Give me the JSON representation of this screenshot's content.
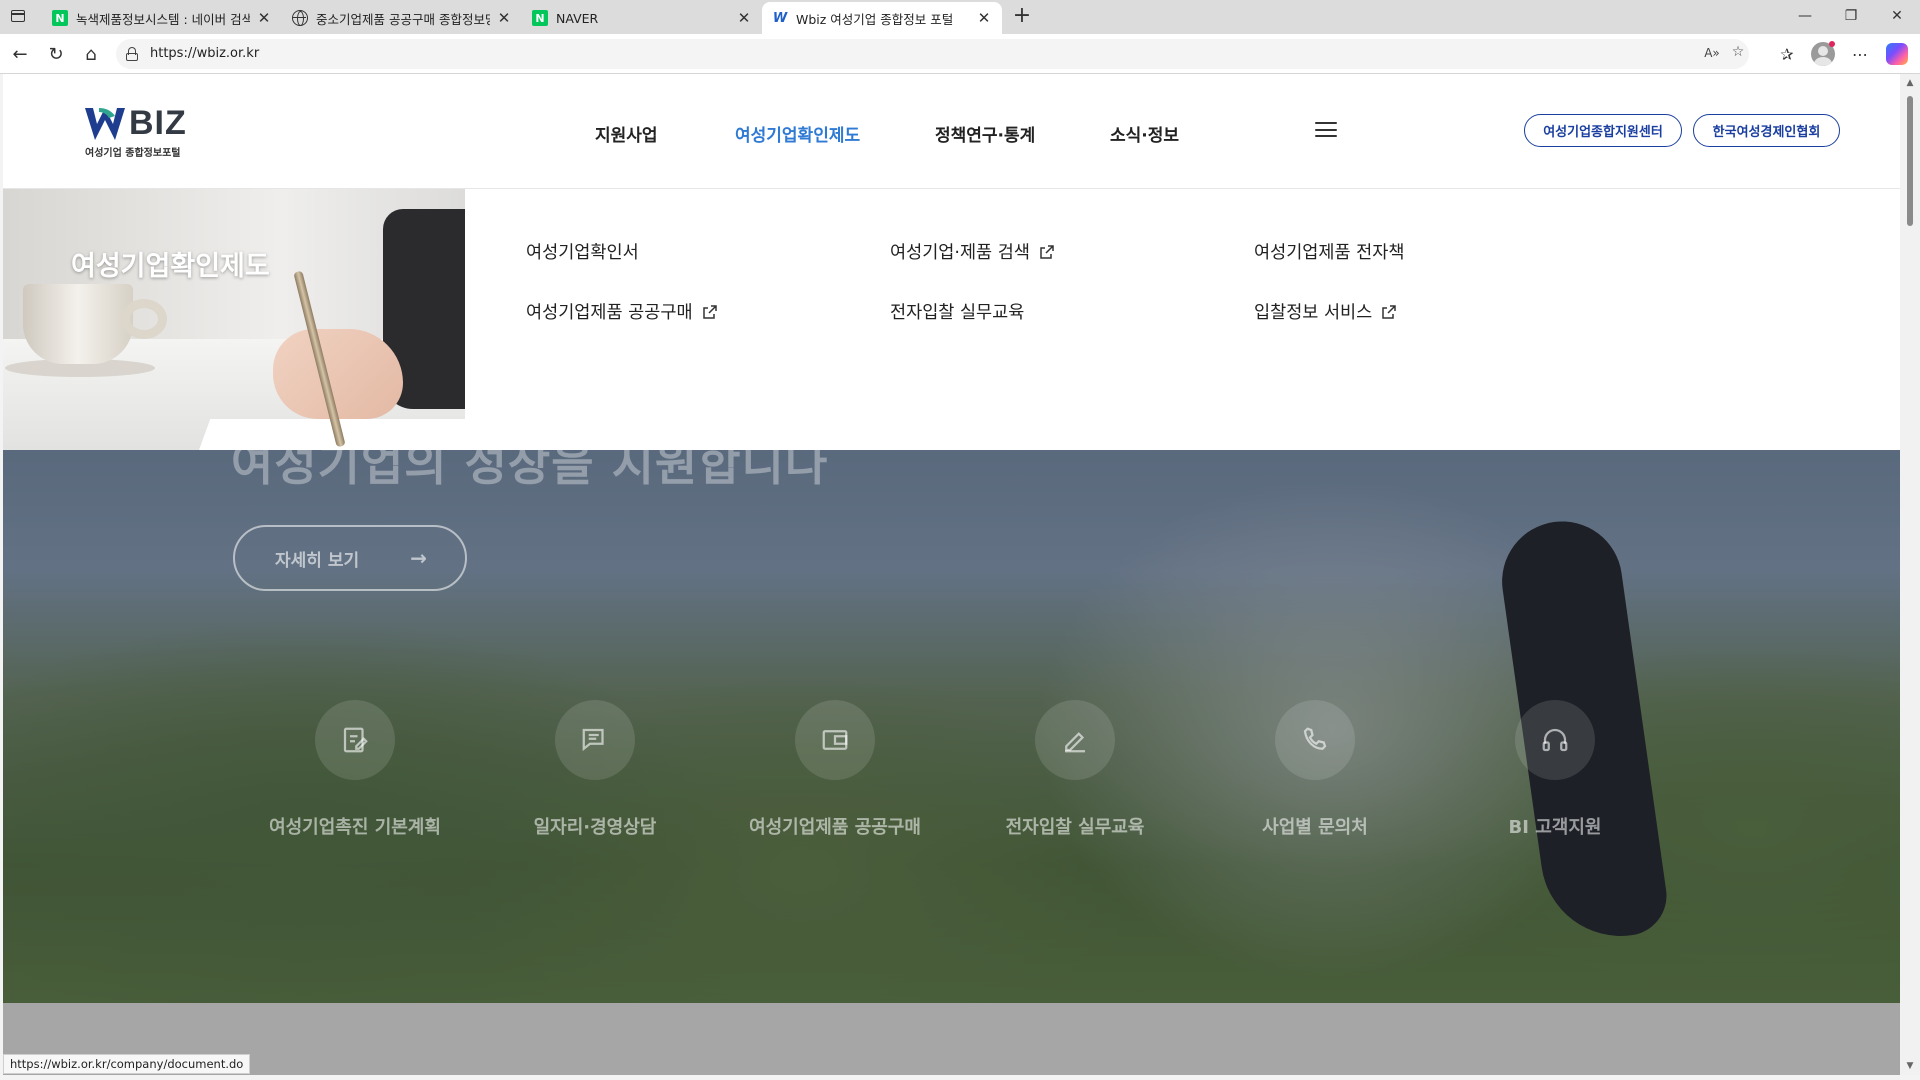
{
  "browser": {
    "tabs": [
      {
        "title": "녹색제품정보시스템 : 네이버 검색",
        "favicon": "naver-icon"
      },
      {
        "title": "중소기업제품 공공구매 종합정보망",
        "favicon": "globe-icon"
      },
      {
        "title": "NAVER",
        "favicon": "naver-icon"
      },
      {
        "title": "Wbiz 여성기업 종합정보 포털",
        "favicon": "wbiz-icon",
        "active": true
      }
    ],
    "url": "https://wbiz.or.kr",
    "status_url": "https://wbiz.or.kr/company/document.do"
  },
  "header": {
    "logo_text": "BIZ",
    "logo_sub": "여성기업 종합정보포털",
    "nav": [
      "지원사업",
      "여성기업확인제도",
      "정책연구·통계",
      "소식·정보"
    ],
    "active_nav_index": 1,
    "pill_buttons": [
      "여성기업종합지원센터",
      "한국여성경제인협회"
    ],
    "accent_color": "#2f7ad4",
    "pill_color": "#1b3fa0"
  },
  "mega_menu": {
    "title": "여성기업확인제도",
    "links": [
      {
        "label": "여성기업확인서",
        "external": false
      },
      {
        "label": "여성기업·제품 검색",
        "external": true
      },
      {
        "label": "여성기업제품 전자책",
        "external": false
      },
      {
        "label": "여성기업제품 공공구매",
        "external": true
      },
      {
        "label": "전자입찰 실무교육",
        "external": false
      },
      {
        "label": "입찰정보 서비스",
        "external": true
      }
    ]
  },
  "hero": {
    "heading": "여성기업의 성장을 지원합니다",
    "detail_button": "자세히 보기",
    "quick_links": [
      {
        "label": "여성기업촉진 기본계획",
        "icon": "edit-document-icon"
      },
      {
        "label": "일자리·경영상담",
        "icon": "chat-icon"
      },
      {
        "label": "여성기업제품 공공구매",
        "icon": "wallet-icon"
      },
      {
        "label": "전자입찰 실무교육",
        "icon": "pencil-icon"
      },
      {
        "label": "사업별 문의처",
        "icon": "phone-icon"
      },
      {
        "label": "BI 고객지원",
        "icon": "headset-icon"
      }
    ]
  }
}
